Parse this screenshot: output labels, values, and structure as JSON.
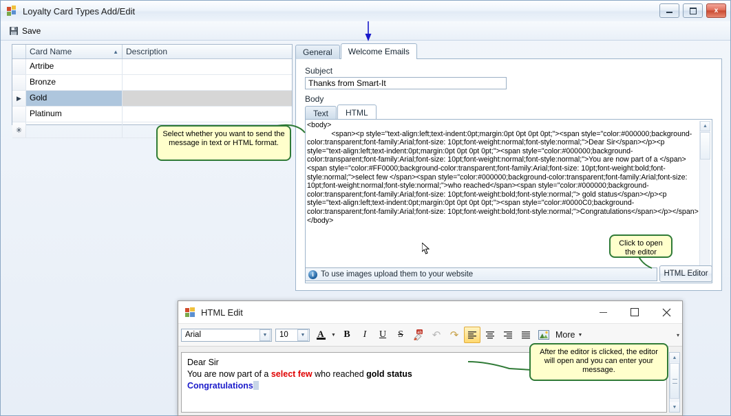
{
  "window": {
    "title": "Loyalty Card Types Add/Edit",
    "icon": "form-icon",
    "buttons": {
      "minimize": "minimize-icon",
      "maximize": "maximize-icon",
      "close": "x"
    }
  },
  "toolbar": {
    "save_label": "Save",
    "save_icon": "floppy-disk-icon"
  },
  "grid": {
    "columns": [
      "Card Name",
      "Description"
    ],
    "sort_indicator": "▲",
    "rows": [
      {
        "marker": "",
        "name": "Artribe",
        "description": ""
      },
      {
        "marker": "",
        "name": "Bronze",
        "description": ""
      },
      {
        "marker": "▶",
        "name": "Gold",
        "description": "",
        "selected": true
      },
      {
        "marker": "",
        "name": "Platinum",
        "description": ""
      },
      {
        "marker": "✳",
        "name": "",
        "description": "",
        "newrow": true
      }
    ]
  },
  "tabs": {
    "items": [
      {
        "label": "General",
        "active": false
      },
      {
        "label": "Welcome Emails",
        "active": true
      }
    ]
  },
  "welcome_emails": {
    "subject_label": "Subject",
    "subject_value": "Thanks from Smart-It",
    "body_label": "Body",
    "body_tabs": [
      {
        "label": "Text",
        "active": false
      },
      {
        "label": "HTML",
        "active": true
      }
    ],
    "html_source": "<body>\n            <span><p style=\"text-align:left;text-indent:0pt;margin:0pt 0pt 0pt 0pt;\"><span style=\"color:#000000;background-color:transparent;font-family:Arial;font-size: 10pt;font-weight:normal;font-style:normal;\">Dear Sir</span></p><p style=\"text-align:left;text-indent:0pt;margin:0pt 0pt 0pt 0pt;\"><span style=\"color:#000000;background-color:transparent;font-family:Arial;font-size: 10pt;font-weight:normal;font-style:normal;\">You are now part of a </span><span style=\"color:#FF0000;background-color:transparent;font-family:Arial;font-size: 10pt;font-weight:bold;font-style:normal;\">select few </span><span style=\"color:#000000;background-color:transparent;font-family:Arial;font-size: 10pt;font-weight:normal;font-style:normal;\">who reached</span><span style=\"color:#000000;background-color:transparent;font-family:Arial;font-size: 10pt;font-weight:bold;font-style:normal;\"> gold status</span></p><p style=\"text-align:left;text-indent:0pt;margin:0pt 0pt 0pt 0pt;\"><span style=\"color:#0000C0;background-color:transparent;font-family:Arial;font-size: 10pt;font-weight:bold;font-style:normal;\">Congratulations</span></p></span></body>",
    "info_text": "To use images upload them to your website",
    "info_icon": "info-icon",
    "html_editor_button": "HTML Editor"
  },
  "callouts": [
    {
      "id": "format-callout",
      "text": "Select whether you want to send the message in text or HTML format."
    },
    {
      "id": "editor-callout",
      "text": "Click to open the editor"
    },
    {
      "id": "after-editor-callout",
      "text": "After the editor is clicked, the editor will open and you can enter your message."
    }
  ],
  "dialog": {
    "title": "HTML Edit",
    "icon": "form-icon",
    "buttons": {
      "minimize": "minimize-icon",
      "maximize": "maximize-icon",
      "close": "close-icon"
    },
    "toolbar": {
      "font_family": "Arial",
      "font_size": "10",
      "font_color_glyph": "A",
      "bold": "B",
      "italic": "I",
      "underline": "U",
      "strikethrough": "S",
      "highlight": "highlighter-icon",
      "undo": "undo-icon",
      "redo": "redo-icon",
      "align_left": "align-left-icon",
      "align_center": "align-center-icon",
      "align_right": "align-right-icon",
      "align_justify": "align-justify-icon",
      "insert_image": "insert-image-icon",
      "more_label": "More",
      "overflow": "▾"
    },
    "content": {
      "line1": "Dear Sir",
      "line2_a": "You are now part of a ",
      "line2_red": "select few",
      "line2_b": " who reached ",
      "line2_bold": "gold status",
      "line3_blue": "Congratulations"
    }
  },
  "colors": {
    "callout_bg": "#ffffcc",
    "callout_border": "#2f7a36",
    "selection": "#aec6dd",
    "red_text": "#FF0000",
    "blue_text": "#0000C0",
    "arrow_blue": "#1a1aca"
  }
}
